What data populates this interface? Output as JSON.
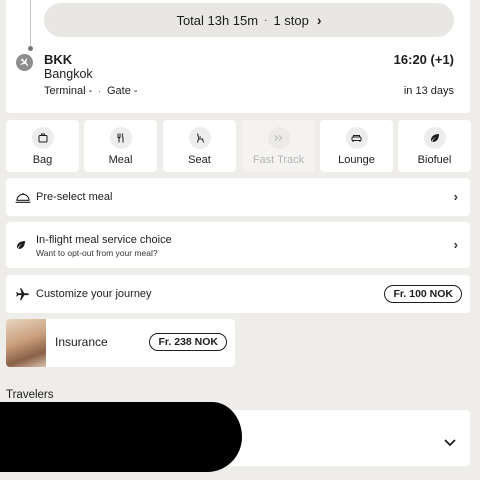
{
  "flight": {
    "total_text": "Total 13h 15m",
    "separator": "·",
    "stops": "1 stop",
    "arrival": {
      "code": "BKK",
      "city": "Bangkok",
      "terminal": "Terminal -",
      "gate": "Gate -",
      "time": "16:20 (+1)",
      "countdown": "in 13 days"
    }
  },
  "services": [
    {
      "label": "Bag",
      "icon": "bag-icon",
      "enabled": true
    },
    {
      "label": "Meal",
      "icon": "meal-icon",
      "enabled": true
    },
    {
      "label": "Seat",
      "icon": "seat-icon",
      "enabled": true
    },
    {
      "label": "Fast Track",
      "icon": "fast-track-icon",
      "enabled": false
    },
    {
      "label": "Lounge",
      "icon": "lounge-icon",
      "enabled": true
    },
    {
      "label": "Biofuel",
      "icon": "leaf-icon",
      "enabled": true
    }
  ],
  "rows": {
    "preselect_meal": {
      "label": "Pre-select meal",
      "icon": "meal-dish-icon"
    },
    "inflight_meal": {
      "label": "In-flight meal service choice",
      "sub": "Want to opt-out from your meal?",
      "icon": "leaf-icon"
    },
    "customize": {
      "label": "Customize your journey",
      "price": "Fr. 100 NOK",
      "icon": "airplane-icon"
    }
  },
  "insurance": {
    "label": "Insurance",
    "price": "Fr. 238 NOK"
  },
  "travelers": {
    "heading": "Travelers"
  }
}
